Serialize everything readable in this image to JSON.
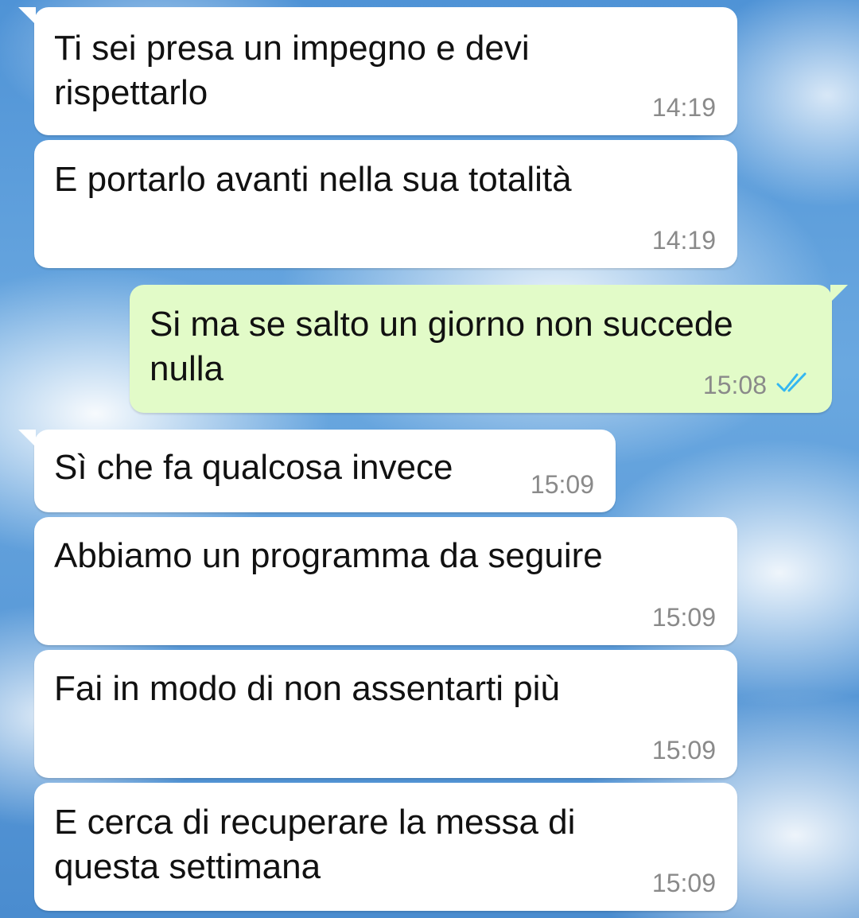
{
  "messages": [
    {
      "direction": "incoming",
      "text": "Ti sei presa un impegno e devi\nrispettarlo",
      "time": "14:19"
    },
    {
      "direction": "incoming",
      "text": "E portarlo avanti nella sua totalità",
      "time": "14:19"
    },
    {
      "direction": "outgoing",
      "text": "Si ma se salto un giorno non succede\nnulla",
      "time": "15:08",
      "status": "read",
      "status_icon": "double-check-icon",
      "status_color": "#34b7f1"
    },
    {
      "direction": "incoming",
      "text": "Sì che fa qualcosa invece",
      "time": "15:09"
    },
    {
      "direction": "incoming",
      "text": "Abbiamo un programma da seguire",
      "time": "15:09"
    },
    {
      "direction": "incoming",
      "text": "Fai in modo di non assentarti più",
      "time": "15:09"
    },
    {
      "direction": "incoming",
      "text": "E cerca di recuperare la messa di\nquesta settimana",
      "time": "15:09"
    }
  ],
  "colors": {
    "incoming_bubble": "#ffffff",
    "outgoing_bubble": "#e2fbc8",
    "timestamp": "#8a8a8a",
    "read_ticks": "#34b7f1"
  }
}
